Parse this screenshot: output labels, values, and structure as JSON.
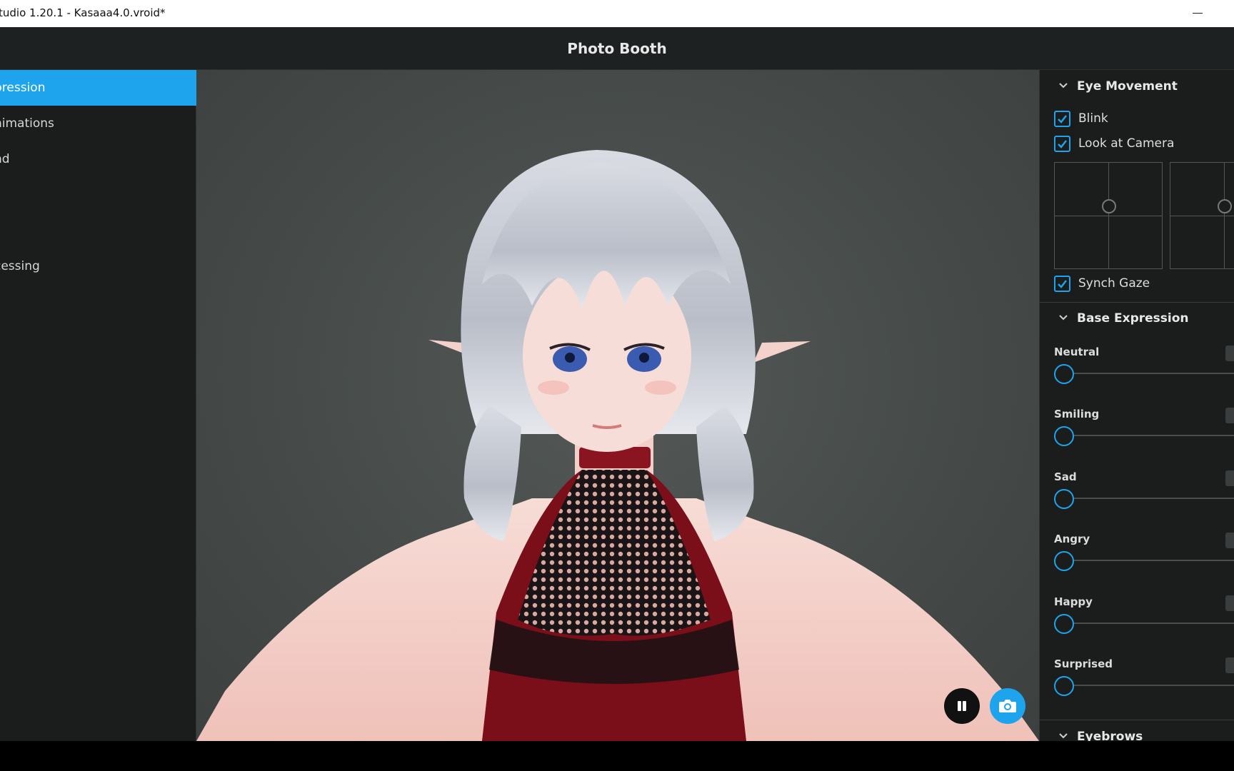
{
  "window": {
    "title": "tudio 1.20.1 - Kasaaa4.0.vroid*"
  },
  "header": {
    "title": "Photo Booth"
  },
  "sidebar": {
    "items": [
      {
        "label": "pression",
        "active": true
      },
      {
        "label": "nimations",
        "active": false
      },
      {
        "label": "nd",
        "active": false
      },
      {
        "label": "cessing",
        "active": false
      }
    ]
  },
  "eye_movement": {
    "title": "Eye Movement",
    "blink": {
      "label": "Blink",
      "checked": true
    },
    "look_at_camera": {
      "label": "Look at Camera",
      "checked": true
    },
    "synch_gaze": {
      "label": "Synch Gaze",
      "checked": true
    }
  },
  "base_expression": {
    "title": "Base Expression",
    "sliders": [
      {
        "label": "Neutral",
        "value": 0
      },
      {
        "label": "Smiling",
        "value": 0
      },
      {
        "label": "Sad",
        "value": 0
      },
      {
        "label": "Angry",
        "value": 0
      },
      {
        "label": "Happy",
        "value": 0
      },
      {
        "label": "Surprised",
        "value": 0
      }
    ]
  },
  "eyebrows": {
    "title": "Eyebrows"
  },
  "colors": {
    "accent": "#1ea4ec",
    "panel": "#1b1d1d",
    "header": "#1e2121"
  },
  "icons": {
    "pause": "pause-icon",
    "camera": "camera-icon",
    "chevron": "chevron-down-icon",
    "check": "checkmark-icon"
  }
}
